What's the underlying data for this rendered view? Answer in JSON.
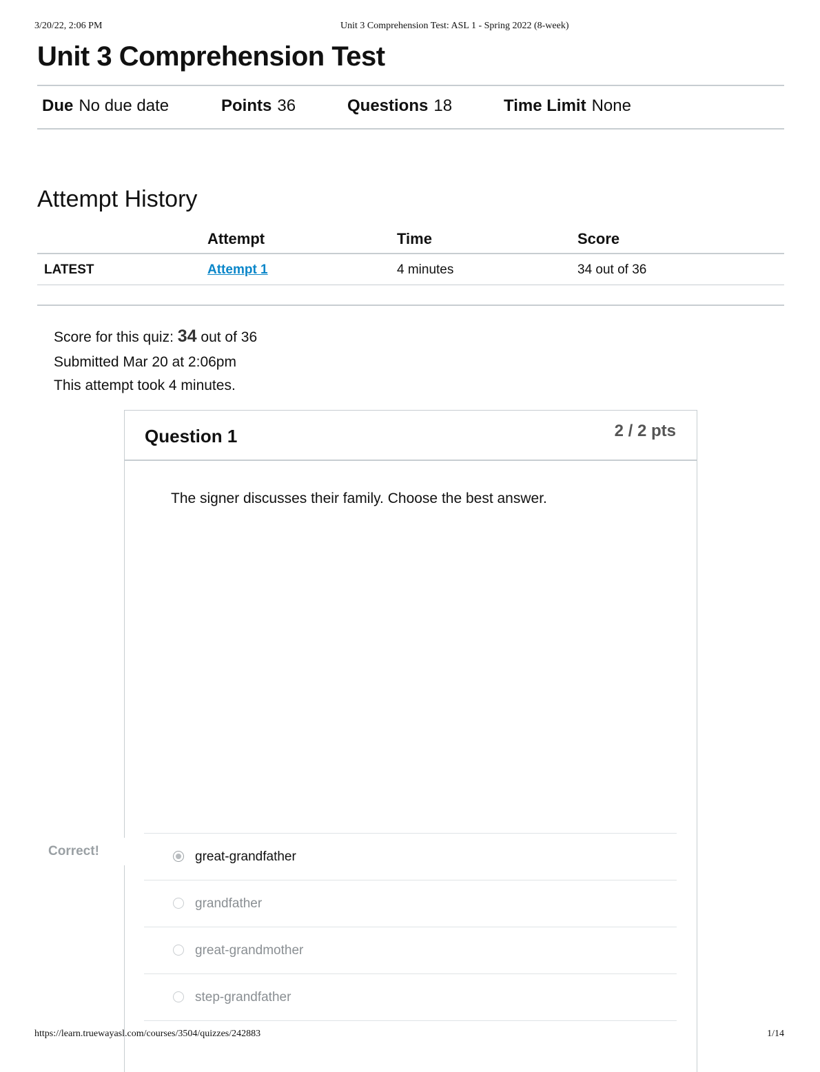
{
  "print_header": {
    "datetime": "3/20/22, 2:06 PM",
    "doc_title": "Unit 3 Comprehension Test: ASL 1 - Spring 2022 (8-week)"
  },
  "quiz": {
    "title": "Unit 3 Comprehension Test",
    "meta": {
      "due_label": "Due",
      "due_value": "No due date",
      "points_label": "Points",
      "points_value": "36",
      "questions_label": "Questions",
      "questions_value": "18",
      "time_limit_label": "Time Limit",
      "time_limit_value": "None"
    }
  },
  "attempt_history": {
    "title": "Attempt History",
    "columns": {
      "attempt": "Attempt",
      "time": "Time",
      "score": "Score"
    },
    "rows": [
      {
        "status": "LATEST",
        "attempt": "Attempt 1",
        "time": "4 minutes",
        "score": "34 out of 36"
      }
    ]
  },
  "summary": {
    "score_prefix": "Score for this quiz:",
    "score_value": "34",
    "score_suffix": "out of 36",
    "submitted": "Submitted Mar 20 at 2:06pm",
    "duration": "This attempt took 4 minutes."
  },
  "question": {
    "title": "Question 1",
    "points": "2 / 2 pts",
    "text": "The signer discusses their family. Choose the best answer.",
    "feedback": "Correct!",
    "answers": [
      {
        "label": "great-grandfather",
        "selected": true
      },
      {
        "label": "grandfather",
        "selected": false
      },
      {
        "label": "great-grandmother",
        "selected": false
      },
      {
        "label": "step-grandfather",
        "selected": false
      }
    ]
  },
  "print_footer": {
    "url": "https://learn.truewayasl.com/courses/3504/quizzes/242883",
    "page": "1/14"
  },
  "colors": {
    "link": "#0a86c9",
    "rule": "#c7cdd1",
    "muted": "#8a8f93"
  }
}
